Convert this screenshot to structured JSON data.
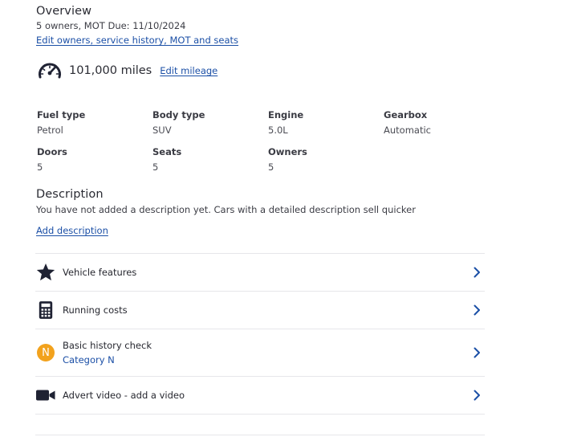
{
  "overview": {
    "title": "Overview",
    "summary": "5 owners, MOT Due: 11/10/2024",
    "edit_link": "Edit owners, service history, MOT and seats"
  },
  "mileage": {
    "icon": "speedometer-icon",
    "value": "101,000 miles",
    "edit_link": "Edit mileage"
  },
  "specs": [
    {
      "label": "Fuel type",
      "value": "Petrol"
    },
    {
      "label": "Body type",
      "value": "SUV"
    },
    {
      "label": "Engine",
      "value": "5.0L"
    },
    {
      "label": "Gearbox",
      "value": "Automatic"
    },
    {
      "label": "Doors",
      "value": "5"
    },
    {
      "label": "Seats",
      "value": "5"
    },
    {
      "label": "Owners",
      "value": "5"
    }
  ],
  "description": {
    "title": "Description",
    "text": "You have not added a description yet. Cars with a detailed description sell quicker",
    "add_link": "Add description"
  },
  "rows": [
    {
      "icon": "star-icon",
      "title": "Vehicle features"
    },
    {
      "icon": "calculator-icon",
      "title": "Running costs"
    },
    {
      "icon": "history-badge-icon",
      "badge": "N",
      "title": "Basic history check",
      "subtitle": "Category N"
    },
    {
      "icon": "video-camera-icon",
      "title": "Advert video - add a video"
    }
  ],
  "colors": {
    "link": "#1b4fa6",
    "badge": "#f2a21d",
    "icon": "#1f2233"
  }
}
